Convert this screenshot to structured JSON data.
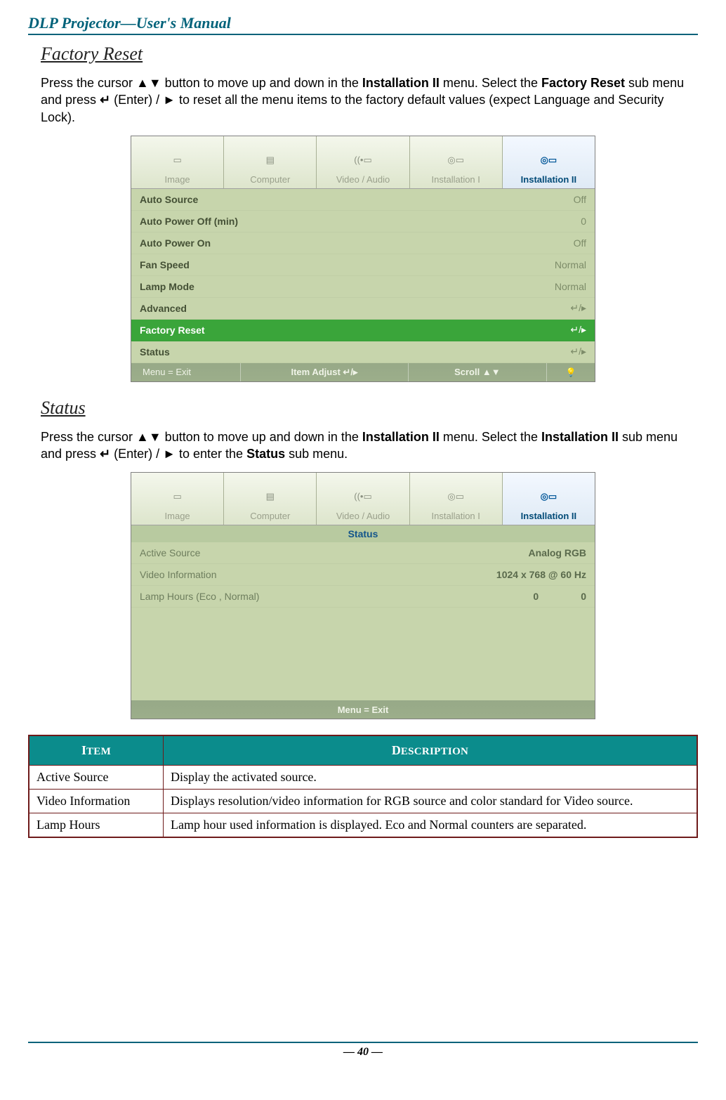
{
  "header": "DLP Projector—User's Manual",
  "section1": {
    "title": "Factory Reset",
    "para_parts": {
      "p1": "Press the cursor ▲▼ button to move up and down in the ",
      "b1": "Installation II",
      "p2": " menu. Select the ",
      "b2": "Factory Reset",
      "p3": " sub menu and press ",
      "enter": "↵",
      "p4": " (Enter) / ► to reset all the menu items to the factory default values (expect Language and Security Lock)."
    }
  },
  "osd1": {
    "tabs": [
      "Image",
      "Computer",
      "Video / Audio",
      "Installation I",
      "Installation II"
    ],
    "rows": [
      {
        "label": "Auto Source",
        "value": "Off"
      },
      {
        "label": "Auto Power Off (min)",
        "value": "0"
      },
      {
        "label": "Auto Power On",
        "value": "Off"
      },
      {
        "label": "Fan Speed",
        "value": "Normal"
      },
      {
        "label": "Lamp Mode",
        "value": "Normal"
      },
      {
        "label": "Advanced",
        "value": "↵/▸"
      },
      {
        "label": "Factory Reset",
        "value": "↵/▸",
        "hl": true
      },
      {
        "label": "Status",
        "value": "↵/▸"
      }
    ],
    "footer": {
      "menu": "Menu = Exit",
      "adjust": "Item Adjust ↵/▸",
      "scroll": "Scroll ▲▼",
      "lamp": "💡"
    }
  },
  "section2": {
    "title": "Status",
    "para_parts": {
      "p1": "Press the cursor ▲▼ button to move up and down in the ",
      "b1": "Installation II",
      "p2": " menu. Select the ",
      "b2": "Installation II",
      "p3": " sub menu and press ",
      "enter": "↵",
      "p4": " (Enter) / ► to enter the ",
      "b3": "Status",
      "p5": " sub menu."
    }
  },
  "osd2": {
    "tabs": [
      "Image",
      "Computer",
      "Video / Audio",
      "Installation I",
      "Installation II"
    ],
    "title": "Status",
    "rows": [
      {
        "label": "Active Source",
        "value": "Analog RGB"
      },
      {
        "label": "Video Information",
        "value": "1024 x 768  @ 60 Hz"
      },
      {
        "label": "Lamp Hours (Eco , Normal)",
        "value_a": "0",
        "value_b": "0"
      }
    ],
    "footer": {
      "menu": "Menu = Exit"
    }
  },
  "desc_table": {
    "head_item": {
      "cap": "I",
      "rest": "TEM"
    },
    "head_desc": {
      "cap": "D",
      "rest": "ESCRIPTION"
    },
    "rows": [
      {
        "item": "Active Source",
        "desc": "Display the activated source."
      },
      {
        "item": "Video Information",
        "desc": "Displays resolution/video information for RGB source and color standard for Video source."
      },
      {
        "item": "Lamp Hours",
        "desc": "Lamp hour used information is displayed. Eco and Normal counters are separated."
      }
    ]
  },
  "footer": "— 40 —"
}
